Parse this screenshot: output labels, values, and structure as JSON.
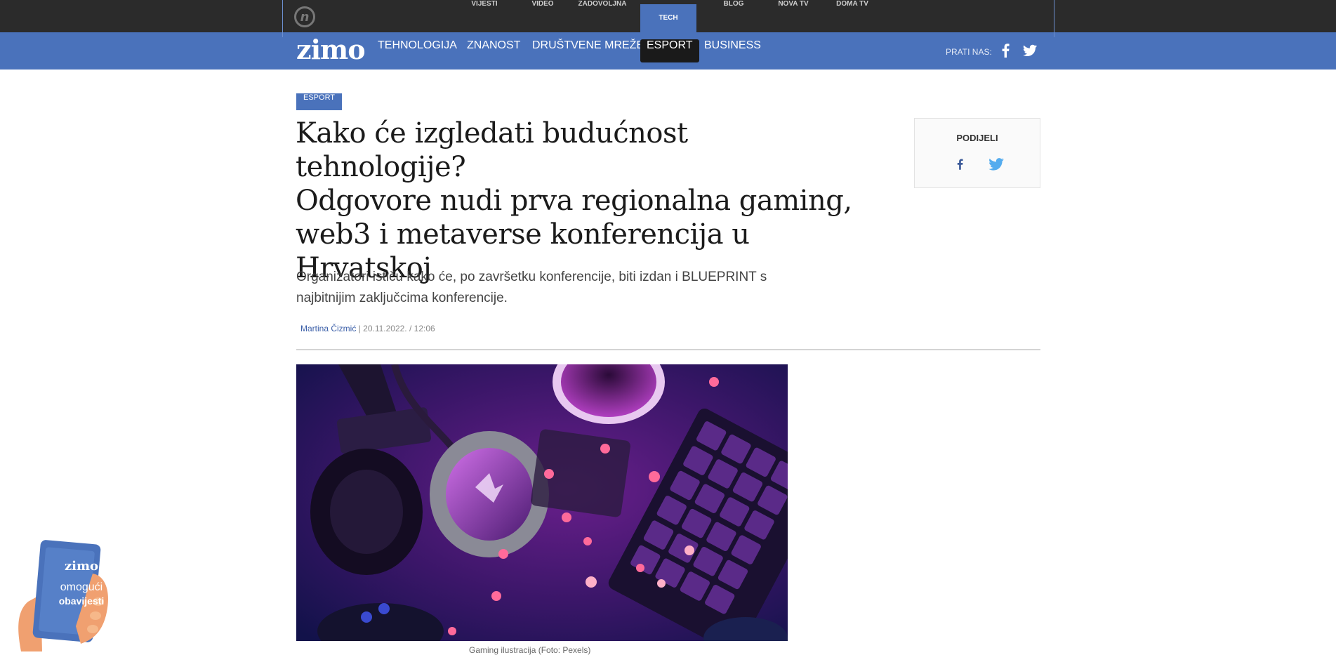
{
  "network_nav": {
    "logo": "n",
    "items": [
      "VIJESTI",
      "VIDEO",
      "ZADOVOLJNA",
      "TECH",
      "BLOG",
      "NOVA TV",
      "DOMA TV"
    ],
    "active": "TECH"
  },
  "zimo_nav": {
    "logo": "zimo",
    "items": [
      "TEHNOLOGIJA",
      "ZNANOST",
      "DRUŠTVENE MREŽE",
      "ESPORT",
      "BUSINESS"
    ],
    "active": "ESPORT",
    "follow_label": "PRATI NAS:",
    "social_icons": [
      "facebook-icon",
      "twitter-icon"
    ]
  },
  "article": {
    "category": "ESPORT",
    "headline_lines": [
      "Kako će izgledati budućnost tehnologije?",
      "Odgovore nudi prva regionalna gaming,",
      "web3 i metaverse konferencija u",
      "Hrvatskoj"
    ],
    "lead_lines": [
      "Organizatori ističu kako će, po završetku konferencije, biti izdan i BLUEPRINT s",
      "najbitnijim zaključcima konferencije."
    ],
    "author": "Martina Čizmić",
    "separator": " | ",
    "date": "20.11.2022. / 12:06",
    "image_caption": "Gaming ilustracija  (Foto: Pexels)"
  },
  "share": {
    "title": "PODIJELI",
    "icons": [
      "facebook-icon",
      "twitter-icon"
    ]
  },
  "notification_widget": {
    "logo": "zimo",
    "line1": "omogući",
    "line2": "obavijesti"
  },
  "colors": {
    "brand_blue": "#4a72bb",
    "topbar": "#2b2b2b",
    "twitter_blue": "#55acee"
  }
}
